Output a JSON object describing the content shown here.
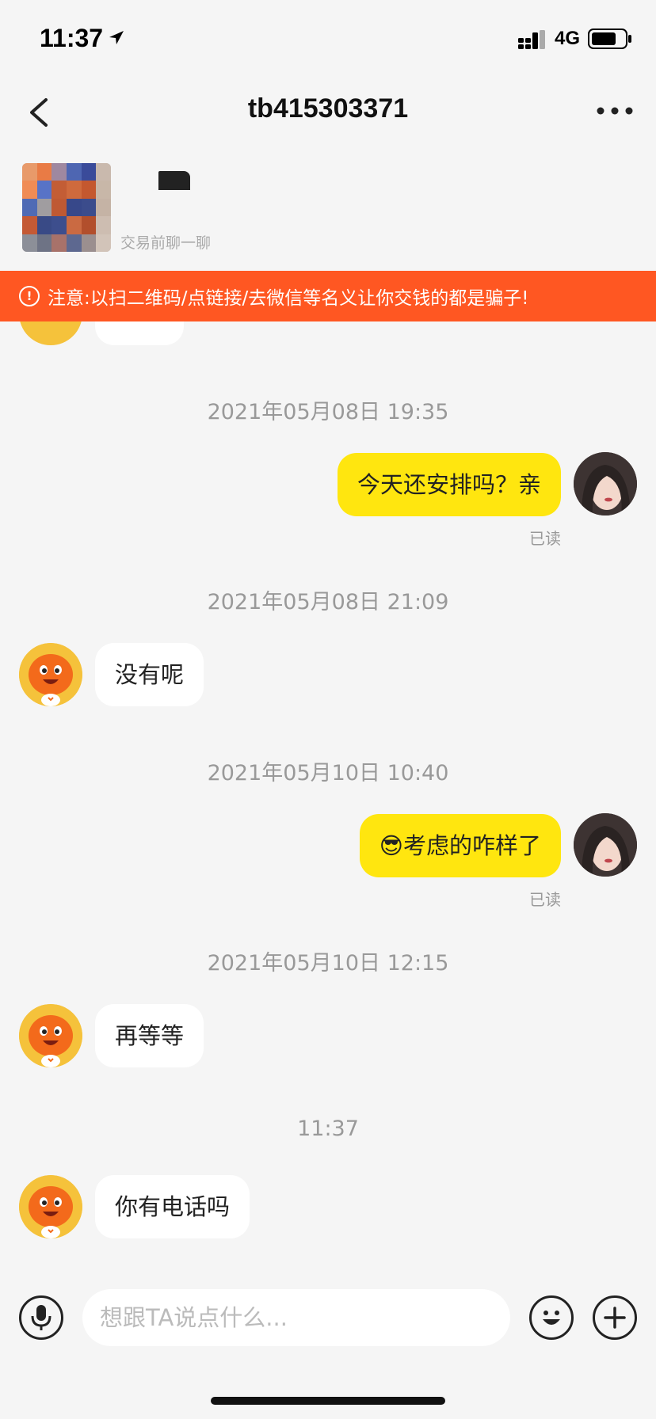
{
  "status_bar": {
    "time": "11:37",
    "network": "4G"
  },
  "nav": {
    "title": "tb415303371"
  },
  "product": {
    "subtitle": "交易前聊一聊"
  },
  "warning": {
    "icon": "!",
    "text": "注意:以扫二维码/点链接/去微信等名义让你交钱的都是骗子!"
  },
  "messages": [
    {
      "timestamp": "2021年05月08日 19:35",
      "direction": "out",
      "text": "今天还安排吗？亲",
      "read": "已读"
    },
    {
      "timestamp": "2021年05月08日 21:09",
      "direction": "in",
      "text": "没有呢"
    },
    {
      "timestamp": "2021年05月10日 10:40",
      "direction": "out",
      "emoji": "😎",
      "text": "考虑的咋样了",
      "read": "已读"
    },
    {
      "timestamp": "2021年05月10日 12:15",
      "direction": "in",
      "text": "再等等"
    },
    {
      "timestamp": "11:37",
      "direction": "in",
      "text": "你有电话吗"
    }
  ],
  "input": {
    "placeholder": "想跟TA说点什么..."
  },
  "icons": {
    "back": "chevron-left-icon",
    "more": "more-dots-icon",
    "voice": "microphone-icon",
    "emoji": "smiley-icon",
    "plus": "plus-icon",
    "warning": "alert-circle-icon"
  },
  "colors": {
    "accent_yellow": "#ffe60f",
    "warning_orange": "#ff5722",
    "background": "#f5f5f5"
  }
}
